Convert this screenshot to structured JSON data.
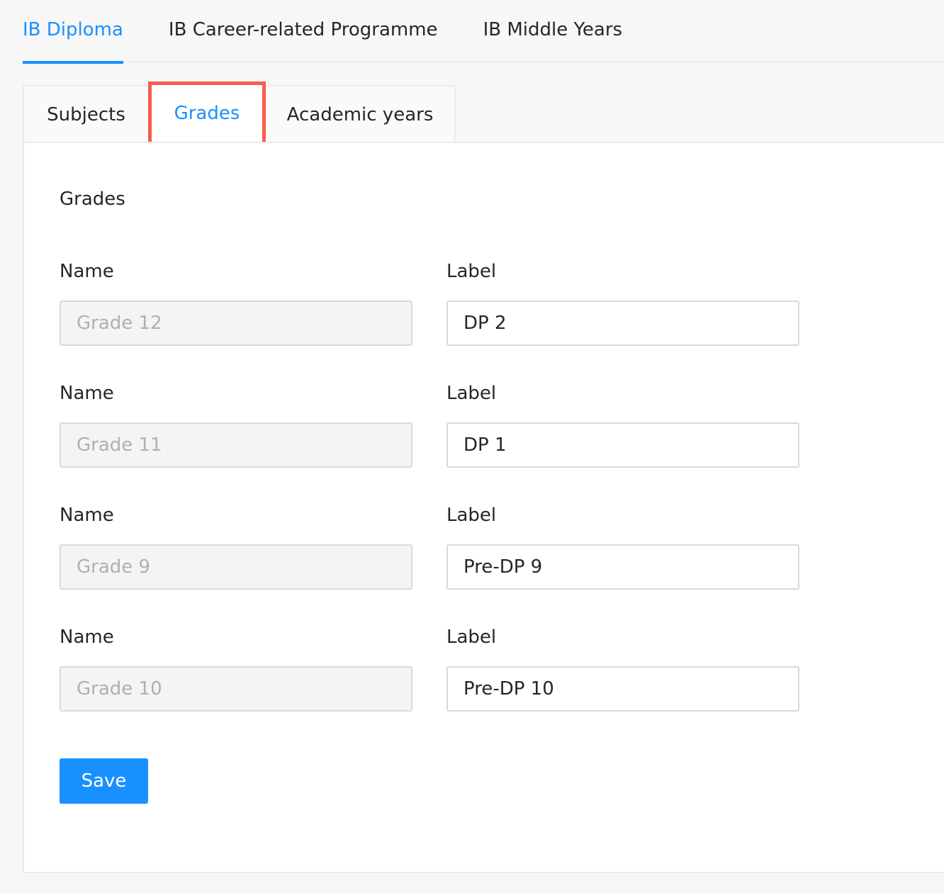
{
  "programme_tabs": [
    {
      "label": "IB Diploma",
      "active": true
    },
    {
      "label": "IB Career-related Programme",
      "active": false
    },
    {
      "label": "IB Middle Years",
      "active": false
    }
  ],
  "section_tabs": [
    {
      "label": "Subjects",
      "active": false
    },
    {
      "label": "Grades",
      "active": true
    },
    {
      "label": "Academic years",
      "active": false
    }
  ],
  "grades": {
    "title": "Grades",
    "name_label": "Name",
    "label_label": "Label",
    "rows": [
      {
        "name": "Grade 12",
        "label": "DP 2"
      },
      {
        "name": "Grade 11",
        "label": "DP 1"
      },
      {
        "name": "Grade 9",
        "label": "Pre-DP 9"
      },
      {
        "name": "Grade 10",
        "label": "Pre-DP 10"
      }
    ],
    "save_label": "Save"
  },
  "colors": {
    "accent": "#1890ff",
    "highlight_box": "#f75c4e"
  }
}
